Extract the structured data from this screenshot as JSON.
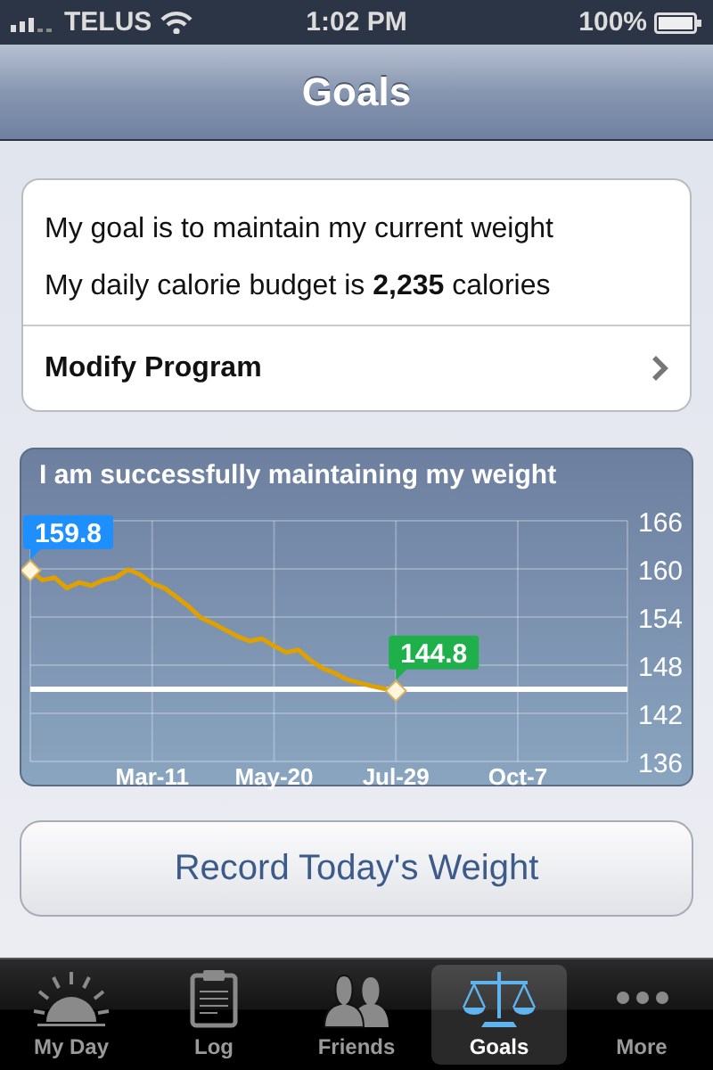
{
  "status_bar": {
    "carrier": "TELUS",
    "time": "1:02 PM",
    "battery": "100%"
  },
  "nav_bar": {
    "title": "Goals"
  },
  "summary": {
    "lines": [
      "My goal is to maintain my current weight",
      "My daily calorie budget is **2,235** calories"
    ],
    "action": "Modify Program"
  },
  "chart_card": {
    "chart_data": {
      "type": "line",
      "title": "I am successfully maintaining my weight",
      "categories": [
        null,
        null,
        null,
        null,
        null,
        null,
        null,
        null,
        null,
        null,
        "Mar-11",
        null,
        null,
        null,
        null,
        null,
        null,
        null,
        null,
        null,
        "May-20",
        null,
        null,
        null,
        null,
        null,
        null,
        null,
        null,
        null,
        "Jul-29",
        null,
        null,
        null,
        null,
        null,
        null,
        null,
        null,
        null,
        "Oct-7",
        null,
        null,
        null,
        null,
        null,
        null,
        null,
        null,
        null
      ],
      "series": [
        {
          "color": "#e0a000",
          "values": [
            159.8,
            158.6,
            158.9,
            157.6,
            158.3,
            157.9,
            158.6,
            158.9,
            159.9,
            159.3,
            158.2,
            157.6,
            156.5,
            155.3,
            153.9,
            153.2,
            152.4,
            151.6,
            151.0,
            151.3,
            150.4,
            149.6,
            149.9,
            148.6,
            147.6,
            147.0,
            146.2,
            145.8,
            145.4,
            145.1,
            144.8,
            null,
            null,
            null,
            null,
            null,
            null,
            null,
            null,
            null,
            null,
            null,
            null,
            null,
            null,
            null,
            null,
            null,
            null,
            null
          ]
        }
      ],
      "ylim": [
        136,
        166
      ],
      "yticks": [
        136,
        142,
        148,
        154,
        160,
        166
      ],
      "grid": true,
      "annotations": [
        "159.8",
        "144.8"
      ],
      "ref_lines": [
        {
          "axis": "y",
          "value": 145
        }
      ]
    }
  },
  "record_button": {
    "label": "Record Today's Weight"
  },
  "tab_bar": {
    "tabs": [
      {
        "kind": "sun",
        "label": "My Day",
        "selected": false
      },
      {
        "kind": "clipboard",
        "label": "Log",
        "selected": false
      },
      {
        "kind": "people",
        "label": "Friends",
        "selected": false
      },
      {
        "kind": "scales",
        "label": "Goals",
        "selected": true
      },
      {
        "kind": "dots",
        "label": "More",
        "selected": false
      }
    ]
  }
}
